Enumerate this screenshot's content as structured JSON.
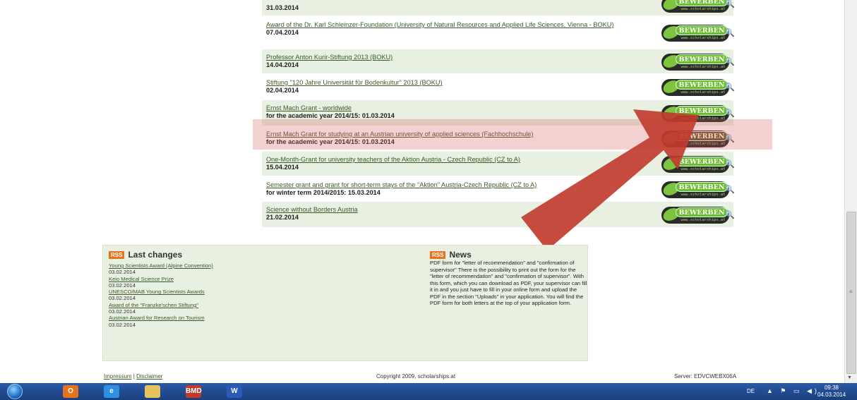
{
  "grants": [
    {
      "title": "",
      "sub": "31.03.2014",
      "dim": false
    },
    {
      "title": "Award of the Dr. Karl Schleinzer-Foundation (University of Natural Resources and Applied Life Sciences, Vienna - BOKU)",
      "sub": "07.04.2014",
      "dim": false
    },
    {
      "title": "Professor Anton Kurir-Stiftung 2013 (BOKU)",
      "sub": "14.04.2014",
      "dim": false
    },
    {
      "title": "Stiftung \"120 Jahre Universität für Bodenkultur\" 2013 (BOKU)",
      "sub": "02.04.2014",
      "dim": false
    },
    {
      "title": "Ernst Mach Grant - worldwide",
      "sub": "for the academic year 2014/15: 01.03.2014",
      "dim": false
    },
    {
      "title": "Ernst Mach Grant for studying at an Austrian university of applied sciences (Fachhochschule)",
      "sub": "for the academic year 2014/15: 01.03.2014",
      "dim": true
    },
    {
      "title": "One-Month-Grant for university teachers of the Aktion Austria - Czech Republic (CZ to A)",
      "sub": "15.04.2014",
      "dim": false
    },
    {
      "title": "Semester grant and grant for short-term stays of the \"Aktion\" Austria-Czech Republic (CZ to A)",
      "sub": "for winter term 2014/2015: 15.03.2014",
      "dim": false
    },
    {
      "title": "Science without Borders Austria",
      "sub": "21.02.2014",
      "dim": false
    }
  ],
  "apply_button": {
    "label": "BEWERBEN",
    "url": "www.scholarships.at"
  },
  "last_changes": {
    "rss_label": "RSS",
    "heading": "Last changes",
    "items": [
      {
        "title": "Young Scientists Award (Alpine Convention)",
        "date": "03.02.2014"
      },
      {
        "title": "Keio Medical Science Prize",
        "date": "03.02.2014"
      },
      {
        "title": "UNESCO/MAB Young Scientists Awards",
        "date": "03.02.2014"
      },
      {
        "title": "Award of the \"Franzke'schen Stiftung\"",
        "date": "03.02.2014"
      },
      {
        "title": "Austrian Award for Research on Tourism",
        "date": "03.02.2014"
      }
    ]
  },
  "news": {
    "rss_label": "RSS",
    "heading": "News",
    "text": "PDF form for \"letter of recommendation\" and \"confirmation of supervisor\" There is the possibility to print out the form for the \"letter of recommendation\" and \"confirmation of supervisor\". With this form, which you can download as PDF, your supervisor can fill it in and you just have to fill in your online form and upload the PDF in the section \"Uploads\" in your application. You will find the PDF form for both letters at the top of your application form."
  },
  "footer": {
    "impressum": "Impressum",
    "separator": "|",
    "disclaimer": "Disclaimer",
    "copyright": "Copyright 2009, scholarships.at",
    "server": "Server: EDVCWEBX06A"
  },
  "taskbar": {
    "apps": [
      {
        "name": "outlook",
        "label": "O",
        "color": "#e8731d"
      },
      {
        "name": "internet-explorer",
        "label": "e",
        "color": "#2f8fe0"
      },
      {
        "name": "file-explorer",
        "label": "",
        "color": "#e8c25a"
      },
      {
        "name": "bmd",
        "label": "BMD",
        "color": "#c0392b"
      },
      {
        "name": "word",
        "label": "W",
        "color": "#2b5bb8"
      }
    ],
    "language": "DE",
    "time": "09:38",
    "date": "04.03.2014"
  },
  "colors": {
    "accent_link": "#3c5a2a",
    "arrow": "#c0392b",
    "highlight": "#d75a5a"
  }
}
